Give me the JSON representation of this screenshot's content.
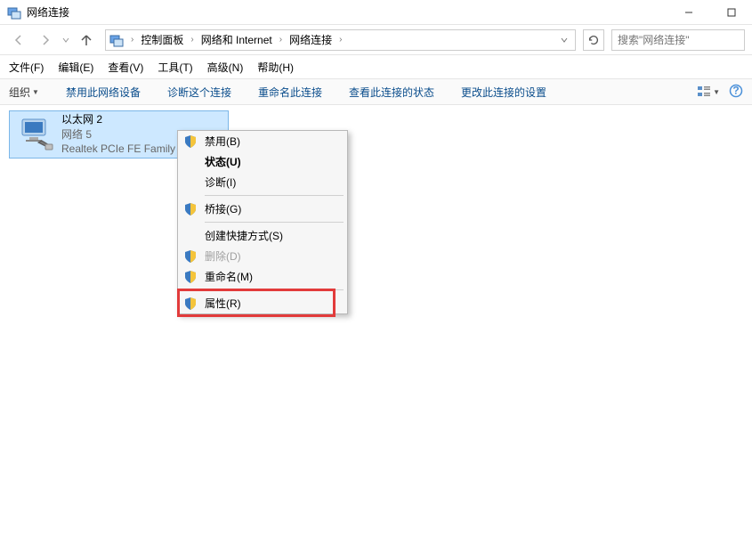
{
  "window": {
    "title": "网络连接"
  },
  "breadcrumb": {
    "items": [
      "控制面板",
      "网络和 Internet",
      "网络连接"
    ]
  },
  "search": {
    "placeholder": "搜索\"网络连接\""
  },
  "menubar": {
    "items": [
      "文件(F)",
      "编辑(E)",
      "查看(V)",
      "工具(T)",
      "高级(N)",
      "帮助(H)"
    ]
  },
  "toolbar": {
    "organize": "组织",
    "items": [
      "禁用此网络设备",
      "诊断这个连接",
      "重命名此连接",
      "查看此连接的状态",
      "更改此连接的设置"
    ]
  },
  "connection": {
    "name": "以太网 2",
    "network": "网络  5",
    "adapter": "Realtek PCIe FE Family"
  },
  "context_menu": {
    "items": [
      {
        "label": "禁用(B)",
        "shield": true,
        "disabled": false,
        "bold": false
      },
      {
        "label": "状态(U)",
        "shield": false,
        "disabled": false,
        "bold": true
      },
      {
        "label": "诊断(I)",
        "shield": false,
        "disabled": false,
        "bold": false
      },
      "sep",
      {
        "label": "桥接(G)",
        "shield": true,
        "disabled": false,
        "bold": false
      },
      "sep",
      {
        "label": "创建快捷方式(S)",
        "shield": false,
        "disabled": false,
        "bold": false
      },
      {
        "label": "删除(D)",
        "shield": true,
        "disabled": true,
        "bold": false
      },
      {
        "label": "重命名(M)",
        "shield": true,
        "disabled": false,
        "bold": false
      },
      "sep",
      {
        "label": "属性(R)",
        "shield": true,
        "disabled": false,
        "bold": false
      }
    ]
  },
  "statusbar": {
    "text": ""
  }
}
